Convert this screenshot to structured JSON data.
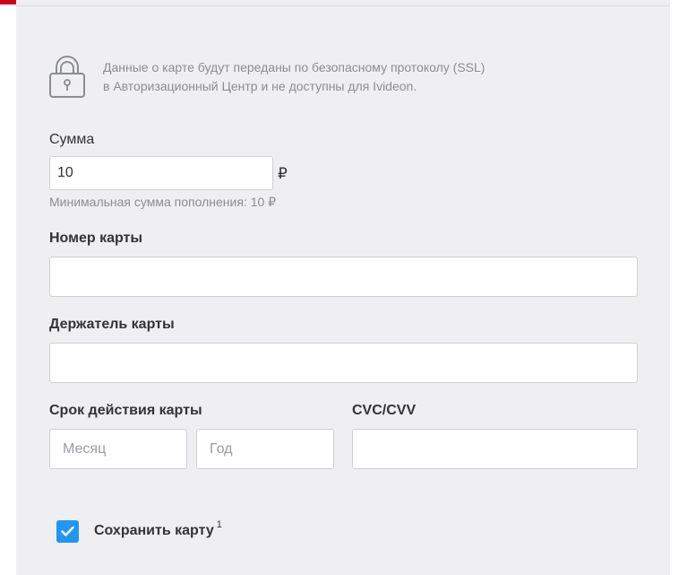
{
  "security_notice": {
    "line1": "Данные о карте будут переданы по безопасному протоколу (SSL)",
    "line2": "в Авторизационный Центр и не доступны для Ivideon.",
    "icon": "lock-icon"
  },
  "amount": {
    "label": "Сумма",
    "value": "10",
    "currency": "₽",
    "hint": "Минимальная сумма пополнения: 10 ₽"
  },
  "card_number": {
    "label": "Номер карты",
    "value": ""
  },
  "card_holder": {
    "label": "Держатель карты",
    "value": ""
  },
  "expiry": {
    "label": "Срок действия карты",
    "month_placeholder": "Месяц",
    "year_placeholder": "Год"
  },
  "cvc": {
    "label": "CVC/CVV",
    "value": ""
  },
  "save_card": {
    "label": "Сохранить карту",
    "footnote": "1",
    "checked": true
  },
  "colors": {
    "accent_red": "#d0021b",
    "checkbox_blue": "#2196f3",
    "panel_bg": "#efeff1"
  }
}
